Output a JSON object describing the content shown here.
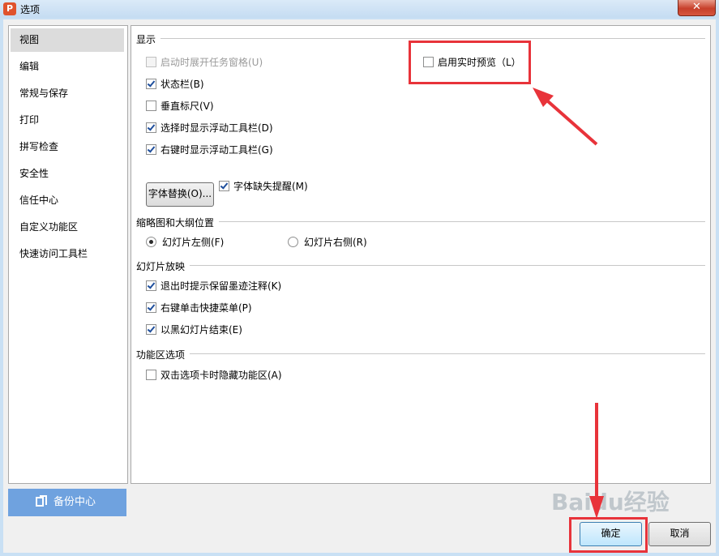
{
  "window": {
    "title": "选项",
    "app_icon_letter": "P",
    "close_glyph": "✕"
  },
  "sidebar": {
    "items": [
      {
        "label": "视图",
        "active": true
      },
      {
        "label": "编辑"
      },
      {
        "label": "常规与保存"
      },
      {
        "label": "打印"
      },
      {
        "label": "拼写检查"
      },
      {
        "label": "安全性"
      },
      {
        "label": "信任中心"
      },
      {
        "label": "自定义功能区"
      },
      {
        "label": "快速访问工具栏"
      }
    ],
    "backup_label": "备份中心"
  },
  "display": {
    "title": "显示",
    "show_taskpane": {
      "label": "启动时展开任务窗格(U)",
      "checked": false,
      "disabled": true
    },
    "status_bar": {
      "label": "状态栏(B)",
      "checked": true
    },
    "vertical_ruler": {
      "label": "垂直标尺(V)",
      "checked": false
    },
    "select_toolbar": {
      "label": "选择时显示浮动工具栏(D)",
      "checked": true
    },
    "rightclick_toolbar": {
      "label": "右键时显示浮动工具栏(G)",
      "checked": true
    },
    "live_preview": {
      "label": "启用实时预览（L）",
      "checked": false
    },
    "font_replace_label": "字体替换(O)...",
    "font_missing": {
      "label": "字体缺失提醒(M)",
      "checked": true
    }
  },
  "thumbnail": {
    "title": "缩略图和大纲位置",
    "left": {
      "label": "幻灯片左侧(F)",
      "checked": true
    },
    "right": {
      "label": "幻灯片右侧(R)",
      "checked": false
    }
  },
  "slideshow": {
    "title": "幻灯片放映",
    "ink_prompt": {
      "label": "退出时提示保留墨迹注释(K)",
      "checked": true
    },
    "rightclick_menu": {
      "label": "右键单击快捷菜单(P)",
      "checked": true
    },
    "end_black": {
      "label": "以黑幻灯片结束(E)",
      "checked": true
    }
  },
  "ribbon": {
    "title": "功能区选项",
    "hide_on_dblclick": {
      "label": "双击选项卡时隐藏功能区(A)",
      "checked": false
    }
  },
  "footer": {
    "ok_label": "确定",
    "cancel_label": "取消"
  },
  "watermark_text": "Baidu经验",
  "colors": {
    "highlight": "#e8333a",
    "backup_button": "#6fa2df"
  }
}
